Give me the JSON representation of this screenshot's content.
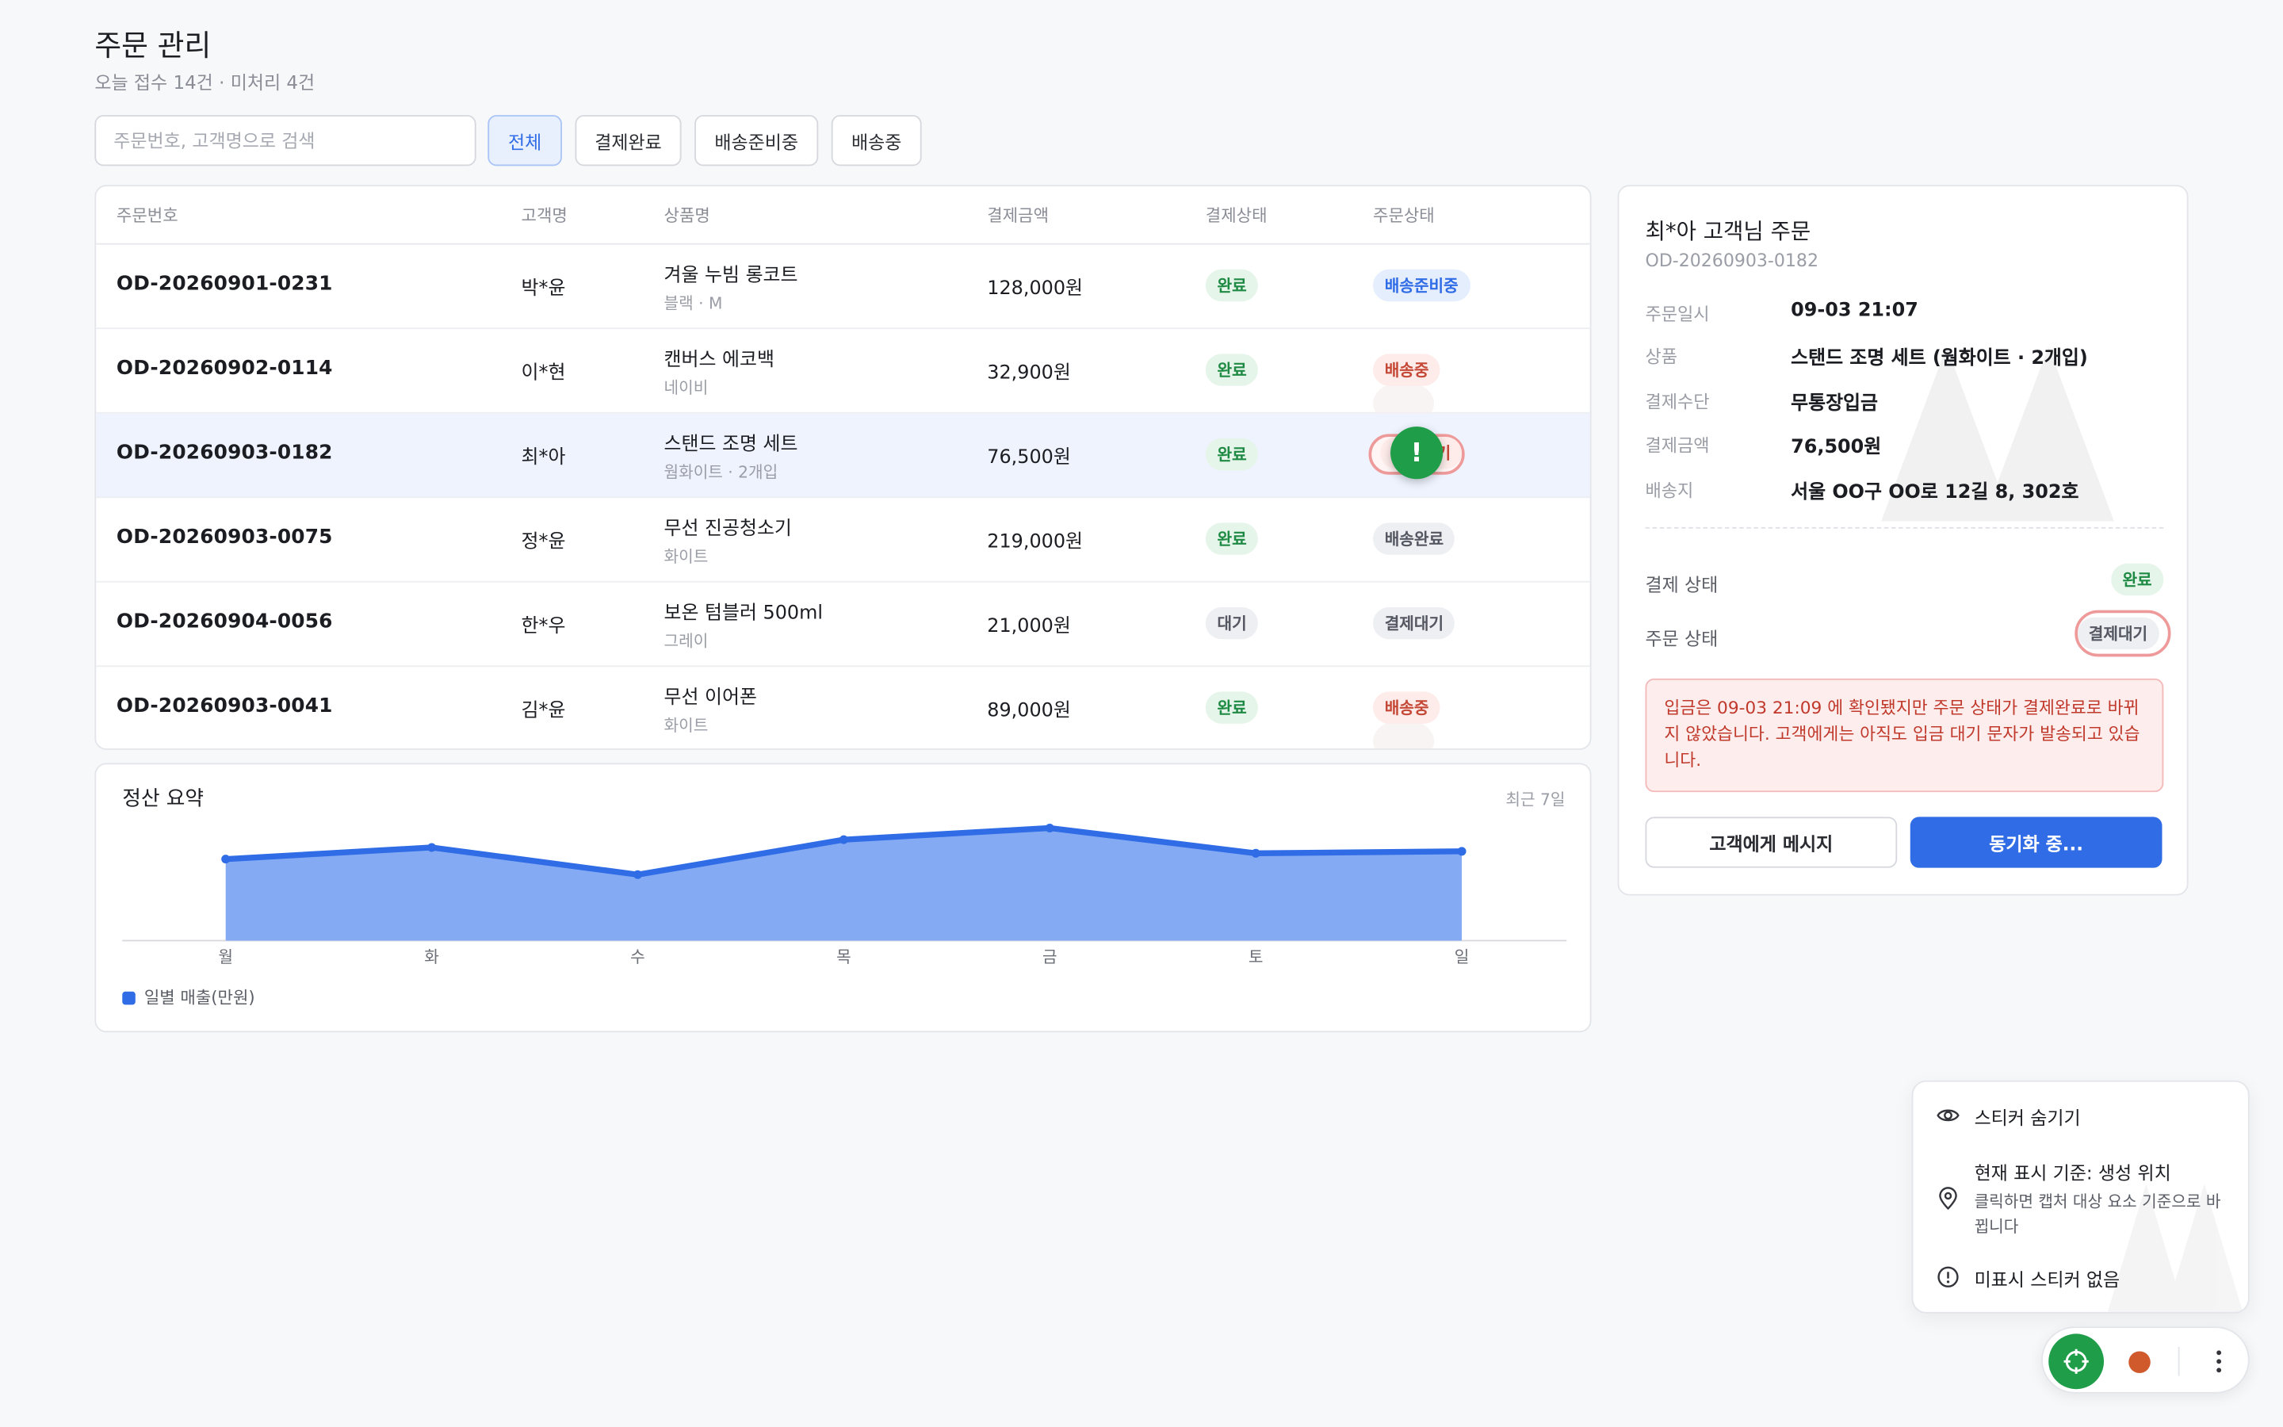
{
  "header": {
    "title": "주문 관리",
    "subtitle": "오늘 접수 14건 · 미처리 4건"
  },
  "search": {
    "placeholder": "주문번호, 고객명으로 검색",
    "value": ""
  },
  "filters": [
    {
      "label": "전체",
      "active": true
    },
    {
      "label": "결제완료",
      "active": false
    },
    {
      "label": "배송준비중",
      "active": false
    },
    {
      "label": "배송중",
      "active": false
    }
  ],
  "table": {
    "columns": [
      "주문번호",
      "고객명",
      "상품명",
      "결제금액",
      "결제상태",
      "주문상태"
    ],
    "rows": [
      {
        "order_no": "OD-20260901-0231",
        "customer": "박*윤",
        "product": "겨울 누빔 롱코트",
        "option": "블랙 · M",
        "amount": "128,000원",
        "pay_status": "완료",
        "order_status": "배송준비중",
        "order_color": "blue"
      },
      {
        "order_no": "OD-20260902-0114",
        "customer": "이*현",
        "product": "캔버스 에코백",
        "option": "네이비",
        "amount": "32,900원",
        "pay_status": "완료",
        "order_status": "배송중",
        "order_color": "red"
      },
      {
        "order_no": "OD-20260903-0182",
        "customer": "최*아",
        "product": "스탠드 조명 세트",
        "option": "웜화이트 · 2개입",
        "amount": "76,500원",
        "pay_status": "완료",
        "order_status": "결제대기",
        "order_color": "red",
        "selected": true
      },
      {
        "order_no": "OD-20260903-0075",
        "customer": "정*윤",
        "product": "무선 진공청소기",
        "option": "화이트",
        "amount": "219,000원",
        "pay_status": "완료",
        "order_status": "배송완료",
        "order_color": "gray"
      },
      {
        "order_no": "OD-20260904-0056",
        "customer": "한*우",
        "product": "보온 텀블러 500ml",
        "option": "그레이",
        "amount": "21,000원",
        "pay_status": "대기",
        "order_status": "결제대기",
        "order_color": "gray"
      },
      {
        "order_no": "OD-20260903-0041",
        "customer": "김*윤",
        "product": "무선 이어폰",
        "option": "화이트",
        "amount": "89,000원",
        "pay_status": "완료",
        "order_status": "배송중",
        "order_color": "red"
      }
    ]
  },
  "chart_panel": {
    "title": "정산 요약",
    "period": "최근 7일",
    "legend": "일별 매출(만원)"
  },
  "chart_data": {
    "type": "area",
    "categories": [
      "월",
      "화",
      "수",
      "목",
      "금",
      "토",
      "일"
    ],
    "series": [
      {
        "name": "일별 매출(만원)",
        "values": [
          42,
          48,
          34,
          52,
          58,
          45,
          46
        ]
      }
    ],
    "ylim": [
      0,
      60
    ],
    "color": "#2f6ce5",
    "fill": "#84aaf4",
    "grid": false,
    "legend_position": "bottom-left"
  },
  "detail": {
    "title": "최*아 고객님 주문",
    "order_no": "OD-20260903-0182",
    "fields": [
      {
        "label": "주문일시",
        "value": "09-03 21:07"
      },
      {
        "label": "상품",
        "value": "스탠드 조명 세트 (웜화이트 · 2개입)"
      },
      {
        "label": "결제수단",
        "value": "무통장입금"
      },
      {
        "label": "결제금액",
        "value": "76,500원"
      },
      {
        "label": "배송지",
        "value": "서울 OO구 OO로 12길 8, 302호"
      }
    ],
    "pay_status_label": "결제 상태",
    "pay_status_value": "완료",
    "order_status_label": "주문 상태",
    "order_status_value": "결제대기",
    "warning": "입금은 09-03 21:09 에 확인됐지만 주문 상태가 결제완료로 바뀌지 않았습니다. 고객에게는 아직도 입금 대기 문자가 발송되고 있습니다.",
    "message_button": "고객에게 메시지",
    "sync_button": "동기화 중..."
  },
  "sticker_popup": {
    "hide_label": "스티커 숨기기",
    "position_label": "현재 표시 기준: 생성 위치",
    "position_hint": "클릭하면 캡처 대상 요소 기준으로 바뀝니다",
    "hidden_label": "미표시 스티커 없음"
  },
  "sticker": {
    "mark": "!"
  },
  "colors": {
    "accent": "#2f6ce5",
    "success": "#1f9d49",
    "danger": "#c54836",
    "record": "#d05a2c"
  }
}
